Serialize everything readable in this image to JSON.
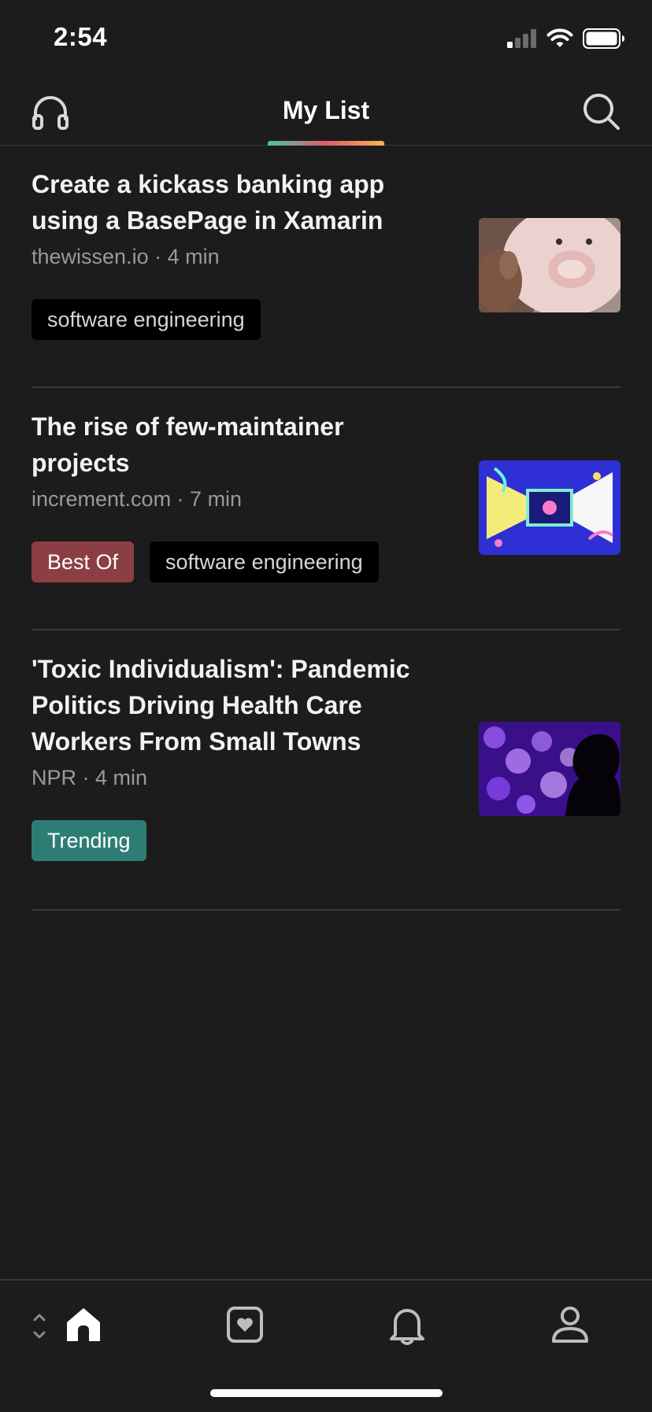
{
  "status_bar": {
    "time": "2:54"
  },
  "header": {
    "title": "My List"
  },
  "articles": [
    {
      "title": "Create a kickass banking app using a BasePage in Xamarin",
      "meta": "thewissen.io · 4 min",
      "tags": [
        "software engineering"
      ],
      "thumbnail": "piggy-bank-photo"
    },
    {
      "title": "The rise of few-maintainer projects",
      "meta": "increment.com · 7 min",
      "tags": [
        "Best Of",
        "software engineering"
      ],
      "thumbnail": "colorful-abstract-illustration"
    },
    {
      "title": "'Toxic Individualism': Pandemic Politics Driving Health Care Workers From Small Towns",
      "meta": "NPR · 4 min",
      "tags": [
        "Trending"
      ],
      "thumbnail": "purple-bokeh-silhouette"
    }
  ],
  "bottom_nav": {
    "items": [
      "home-icon",
      "saves-icon",
      "notifications-icon",
      "profile-icon"
    ]
  },
  "colors": {
    "background": "#1c1c1c",
    "tag_best_of": "#8b3f45",
    "tag_trending": "#2e7d74",
    "tag_default": "#000000"
  }
}
